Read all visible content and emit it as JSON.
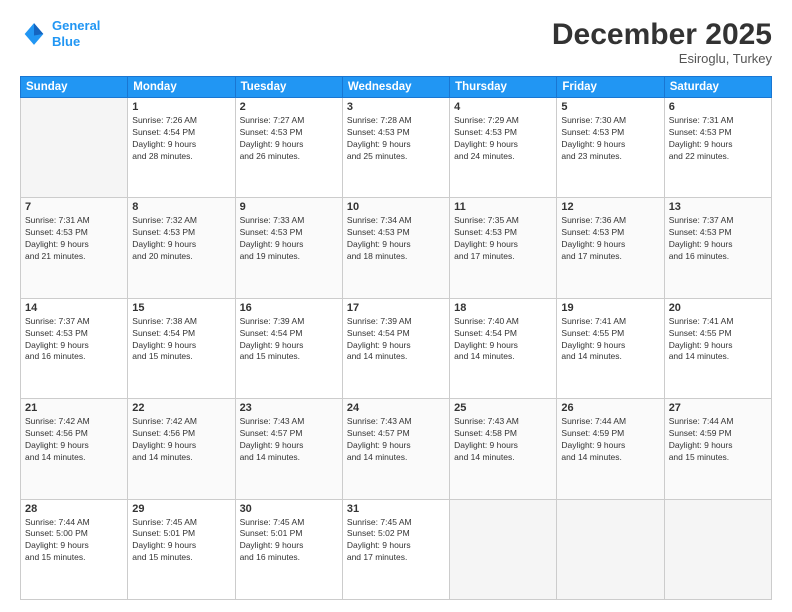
{
  "header": {
    "logo_line1": "General",
    "logo_line2": "Blue",
    "month": "December 2025",
    "location": "Esiroglu, Turkey"
  },
  "weekdays": [
    "Sunday",
    "Monday",
    "Tuesday",
    "Wednesday",
    "Thursday",
    "Friday",
    "Saturday"
  ],
  "weeks": [
    [
      {
        "day": "",
        "info": ""
      },
      {
        "day": "1",
        "info": "Sunrise: 7:26 AM\nSunset: 4:54 PM\nDaylight: 9 hours\nand 28 minutes."
      },
      {
        "day": "2",
        "info": "Sunrise: 7:27 AM\nSunset: 4:53 PM\nDaylight: 9 hours\nand 26 minutes."
      },
      {
        "day": "3",
        "info": "Sunrise: 7:28 AM\nSunset: 4:53 PM\nDaylight: 9 hours\nand 25 minutes."
      },
      {
        "day": "4",
        "info": "Sunrise: 7:29 AM\nSunset: 4:53 PM\nDaylight: 9 hours\nand 24 minutes."
      },
      {
        "day": "5",
        "info": "Sunrise: 7:30 AM\nSunset: 4:53 PM\nDaylight: 9 hours\nand 23 minutes."
      },
      {
        "day": "6",
        "info": "Sunrise: 7:31 AM\nSunset: 4:53 PM\nDaylight: 9 hours\nand 22 minutes."
      }
    ],
    [
      {
        "day": "7",
        "info": "Sunrise: 7:31 AM\nSunset: 4:53 PM\nDaylight: 9 hours\nand 21 minutes."
      },
      {
        "day": "8",
        "info": "Sunrise: 7:32 AM\nSunset: 4:53 PM\nDaylight: 9 hours\nand 20 minutes."
      },
      {
        "day": "9",
        "info": "Sunrise: 7:33 AM\nSunset: 4:53 PM\nDaylight: 9 hours\nand 19 minutes."
      },
      {
        "day": "10",
        "info": "Sunrise: 7:34 AM\nSunset: 4:53 PM\nDaylight: 9 hours\nand 18 minutes."
      },
      {
        "day": "11",
        "info": "Sunrise: 7:35 AM\nSunset: 4:53 PM\nDaylight: 9 hours\nand 17 minutes."
      },
      {
        "day": "12",
        "info": "Sunrise: 7:36 AM\nSunset: 4:53 PM\nDaylight: 9 hours\nand 17 minutes."
      },
      {
        "day": "13",
        "info": "Sunrise: 7:37 AM\nSunset: 4:53 PM\nDaylight: 9 hours\nand 16 minutes."
      }
    ],
    [
      {
        "day": "14",
        "info": "Sunrise: 7:37 AM\nSunset: 4:53 PM\nDaylight: 9 hours\nand 16 minutes."
      },
      {
        "day": "15",
        "info": "Sunrise: 7:38 AM\nSunset: 4:54 PM\nDaylight: 9 hours\nand 15 minutes."
      },
      {
        "day": "16",
        "info": "Sunrise: 7:39 AM\nSunset: 4:54 PM\nDaylight: 9 hours\nand 15 minutes."
      },
      {
        "day": "17",
        "info": "Sunrise: 7:39 AM\nSunset: 4:54 PM\nDaylight: 9 hours\nand 14 minutes."
      },
      {
        "day": "18",
        "info": "Sunrise: 7:40 AM\nSunset: 4:54 PM\nDaylight: 9 hours\nand 14 minutes."
      },
      {
        "day": "19",
        "info": "Sunrise: 7:41 AM\nSunset: 4:55 PM\nDaylight: 9 hours\nand 14 minutes."
      },
      {
        "day": "20",
        "info": "Sunrise: 7:41 AM\nSunset: 4:55 PM\nDaylight: 9 hours\nand 14 minutes."
      }
    ],
    [
      {
        "day": "21",
        "info": "Sunrise: 7:42 AM\nSunset: 4:56 PM\nDaylight: 9 hours\nand 14 minutes."
      },
      {
        "day": "22",
        "info": "Sunrise: 7:42 AM\nSunset: 4:56 PM\nDaylight: 9 hours\nand 14 minutes."
      },
      {
        "day": "23",
        "info": "Sunrise: 7:43 AM\nSunset: 4:57 PM\nDaylight: 9 hours\nand 14 minutes."
      },
      {
        "day": "24",
        "info": "Sunrise: 7:43 AM\nSunset: 4:57 PM\nDaylight: 9 hours\nand 14 minutes."
      },
      {
        "day": "25",
        "info": "Sunrise: 7:43 AM\nSunset: 4:58 PM\nDaylight: 9 hours\nand 14 minutes."
      },
      {
        "day": "26",
        "info": "Sunrise: 7:44 AM\nSunset: 4:59 PM\nDaylight: 9 hours\nand 14 minutes."
      },
      {
        "day": "27",
        "info": "Sunrise: 7:44 AM\nSunset: 4:59 PM\nDaylight: 9 hours\nand 15 minutes."
      }
    ],
    [
      {
        "day": "28",
        "info": "Sunrise: 7:44 AM\nSunset: 5:00 PM\nDaylight: 9 hours\nand 15 minutes."
      },
      {
        "day": "29",
        "info": "Sunrise: 7:45 AM\nSunset: 5:01 PM\nDaylight: 9 hours\nand 15 minutes."
      },
      {
        "day": "30",
        "info": "Sunrise: 7:45 AM\nSunset: 5:01 PM\nDaylight: 9 hours\nand 16 minutes."
      },
      {
        "day": "31",
        "info": "Sunrise: 7:45 AM\nSunset: 5:02 PM\nDaylight: 9 hours\nand 17 minutes."
      },
      {
        "day": "",
        "info": ""
      },
      {
        "day": "",
        "info": ""
      },
      {
        "day": "",
        "info": ""
      }
    ]
  ]
}
